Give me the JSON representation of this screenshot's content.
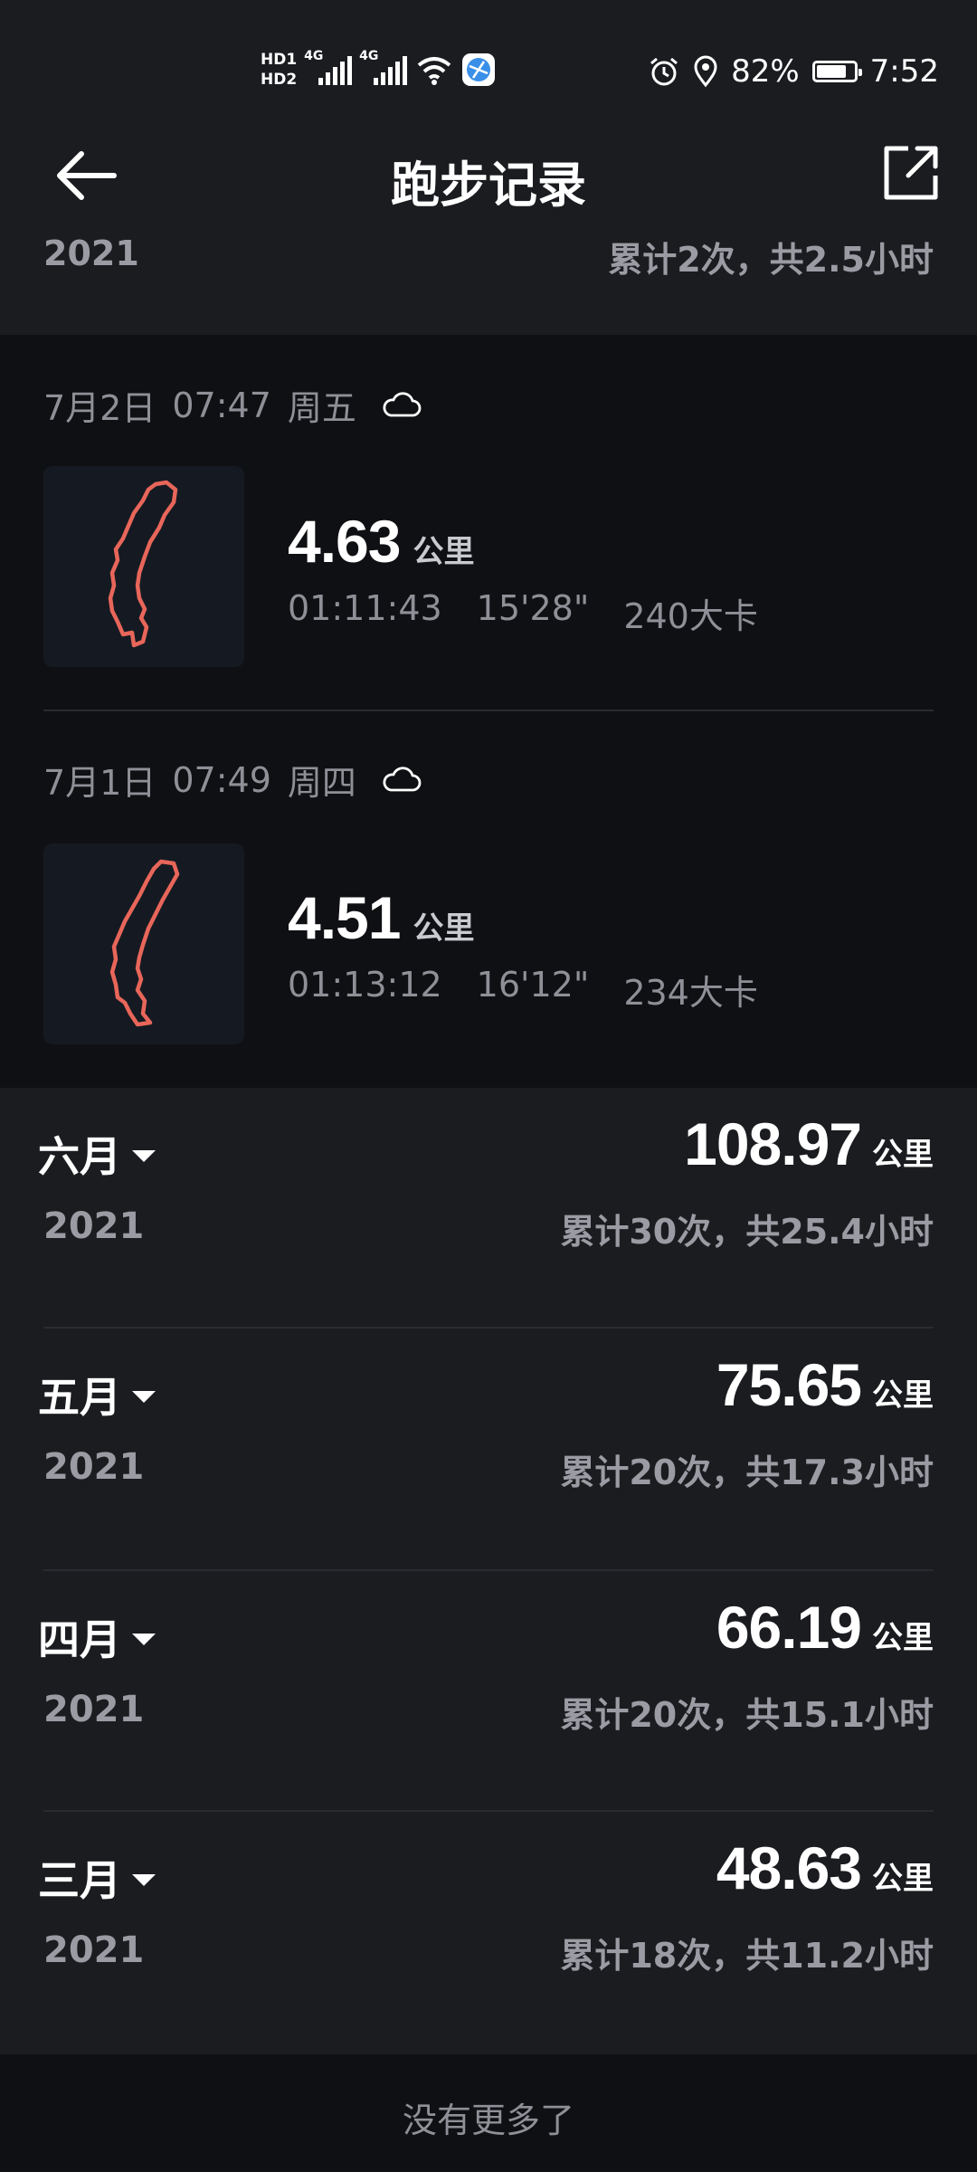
{
  "status_bar": {
    "hd1": "HD1",
    "hd2": "HD2",
    "net1": "4G",
    "net2": "4G",
    "battery": "82%",
    "battery_level": 0.82,
    "time": "7:52",
    "icons": [
      "signal-icon",
      "wifi-icon",
      "browser-icon",
      "alarm-icon",
      "location-icon",
      "battery-icon"
    ]
  },
  "header": {
    "title": "跑步记录"
  },
  "current_month": {
    "year": "2021",
    "stats": "累计2次，共2.5小时"
  },
  "records": [
    {
      "date": "7月2日",
      "time": "07:47",
      "weekday": "周五",
      "weather_icon": "cloud-icon",
      "distance": "4.63",
      "unit": "公里",
      "duration": "01:11:43",
      "pace": "15'28\"",
      "calories": "240大卡"
    },
    {
      "date": "7月1日",
      "time": "07:49",
      "weekday": "周四",
      "weather_icon": "cloud-icon",
      "distance": "4.51",
      "unit": "公里",
      "duration": "01:13:12",
      "pace": "16'12\"",
      "calories": "234大卡"
    }
  ],
  "months": [
    {
      "name": "六月",
      "year": "2021",
      "distance": "108.97",
      "unit": "公里",
      "stats": "累计30次，共25.4小时"
    },
    {
      "name": "五月",
      "year": "2021",
      "distance": "75.65",
      "unit": "公里",
      "stats": "累计20次，共17.3小时"
    },
    {
      "name": "四月",
      "year": "2021",
      "distance": "66.19",
      "unit": "公里",
      "stats": "累计20次，共15.1小时"
    },
    {
      "name": "三月",
      "year": "2021",
      "distance": "48.63",
      "unit": "公里",
      "stats": "累计18次，共11.2小时"
    }
  ],
  "footer": {
    "text": "没有更多了"
  },
  "colors": {
    "background": "#1b1c20",
    "records_background": "#0f1013",
    "route": "#e8665a",
    "muted_text": "#9b9ca3"
  }
}
